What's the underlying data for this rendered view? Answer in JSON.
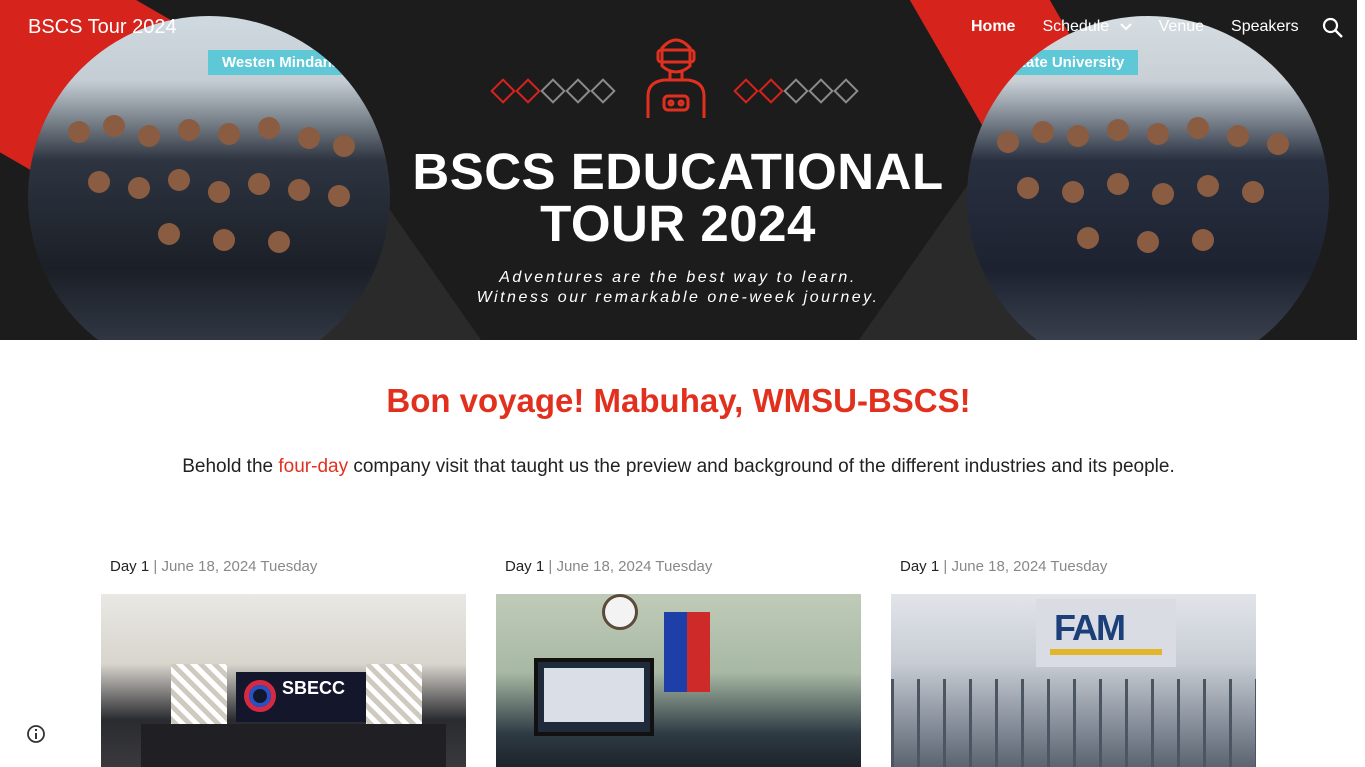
{
  "site": {
    "title": "BSCS Tour 2024"
  },
  "nav": {
    "items": [
      {
        "label": "Home",
        "active": true
      },
      {
        "label": "Schedule",
        "has_dropdown": true
      },
      {
        "label": "Venue"
      },
      {
        "label": "Speakers"
      }
    ],
    "search_icon": "search-icon"
  },
  "banner": {
    "title_line1": "BSCS EDUCATIONAL",
    "title_line2": "TOUR 2024",
    "tagline_line1": "Adventures are the best way to learn.",
    "tagline_line2": "Witness our remarkable one-week journey.",
    "left_photo_sign": "Westen Mindana",
    "right_photo_sign": "State University",
    "icon": "vr-headset-person-icon"
  },
  "main": {
    "headline": "Bon voyage! Mabuhay, WMSU-BSCS!",
    "intro_before": "Behold the ",
    "intro_highlight": "four-day",
    "intro_after": " company visit that taught us the preview and background of the different industries and its people."
  },
  "cards": [
    {
      "day": "Day 1",
      "separator": "|",
      "date": "June 18, 2024 Tuesday",
      "image_sign": "SBECC"
    },
    {
      "day": "Day 1",
      "separator": "|",
      "date": "June 18, 2024 Tuesday"
    },
    {
      "day": "Day 1",
      "separator": "|",
      "date": "June 18, 2024 Tuesday",
      "image_sign": "FAM"
    }
  ],
  "colors": {
    "accent": "#e2301f",
    "banner_bg": "#1c1c1c",
    "banner_red": "#d6231b"
  }
}
